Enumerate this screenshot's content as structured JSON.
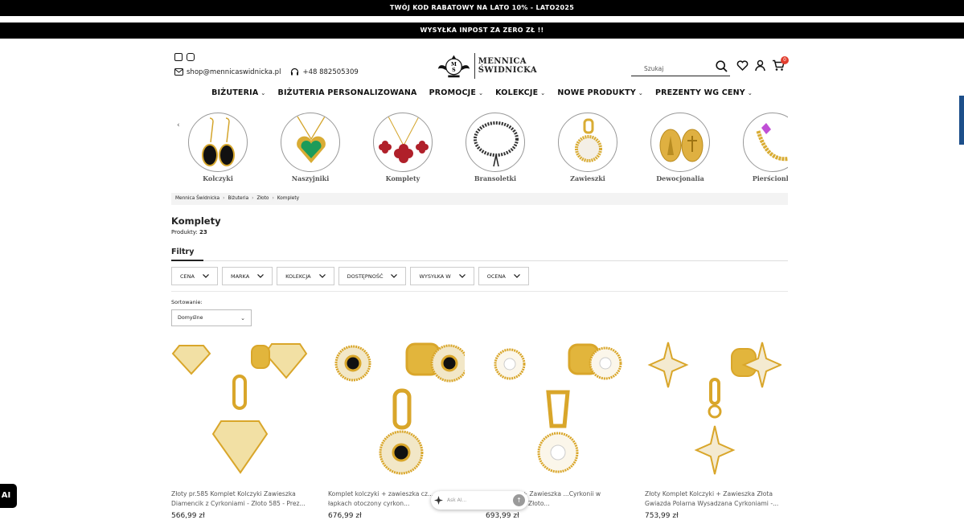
{
  "promo_bar": {
    "text": "TWÓJ KOD RABATOWY NA LATO 10% - LATO2025"
  },
  "shipping_bar": {
    "text": "WYSYŁKA INPOST ZA ZERO ZŁ !!"
  },
  "header": {
    "email": "shop@mennicaswidnicka.pl",
    "phone": "+48 882505309",
    "logo_line1": "MENNICA",
    "logo_line2": "ŚWIDNICKA",
    "search_placeholder": "Szukaj",
    "cart_count": "0"
  },
  "nav": [
    {
      "label": "BIŻUTERIA",
      "has_dropdown": true
    },
    {
      "label": "BIŻUTERIA PERSONALIZOWANA",
      "has_dropdown": false
    },
    {
      "label": "PROMOCJE",
      "has_dropdown": true
    },
    {
      "label": "KOLEKCJE",
      "has_dropdown": true
    },
    {
      "label": "NOWE PRODUKTY",
      "has_dropdown": true
    },
    {
      "label": "PREZENTY WG CENY",
      "has_dropdown": true
    }
  ],
  "categories": [
    {
      "label": "Kolczyki"
    },
    {
      "label": "Naszyjniki"
    },
    {
      "label": "Komplety"
    },
    {
      "label": "Bransoletki"
    },
    {
      "label": "Zawieszki"
    },
    {
      "label": "Dewocjonalia"
    },
    {
      "label": "Pierścionki"
    }
  ],
  "breadcrumb": [
    "Mennica Świdnicka",
    "Biżuteria",
    "Złoto",
    "Komplety"
  ],
  "page": {
    "title": "Komplety",
    "count_label": "Produkty:",
    "count": "23"
  },
  "filters": {
    "title": "Filtry",
    "items": [
      "CENA",
      "MARKA",
      "KOLEKCJA",
      "DOSTĘPNOŚĆ",
      "WYSYŁKA W",
      "OCENA"
    ]
  },
  "sort": {
    "label": "Sortowanie:",
    "value": "Domyślne"
  },
  "products": [
    {
      "title": "Złoty pr.585 Komplet Kolczyki Zawieszka Diamencik z Cyrkoniami - Złoto 585 - Prez...",
      "price": "566,99 zł"
    },
    {
      "title": "Komplet kolczyki + zawieszka cz... złotych łapkach otoczony cyrkon...",
      "price": "676,99 zł"
    },
    {
      "title": "...t Kolczyki + Zawieszka ...Cyrkonii w Złotym Kole - Złoto...",
      "price": "693,99 zł"
    },
    {
      "title": "Złoty Komplet Kolczyki + Zawieszka Złota Gwiazda Polarna Wysadzana Cyrkoniami -...",
      "price": "753,99 zł"
    }
  ],
  "ask_ai": {
    "placeholder": "Ask AI...",
    "side_label": "AI"
  },
  "colors": {
    "bar": "#000000",
    "gold": "#e2b53c",
    "badge": "#e23d2e"
  }
}
